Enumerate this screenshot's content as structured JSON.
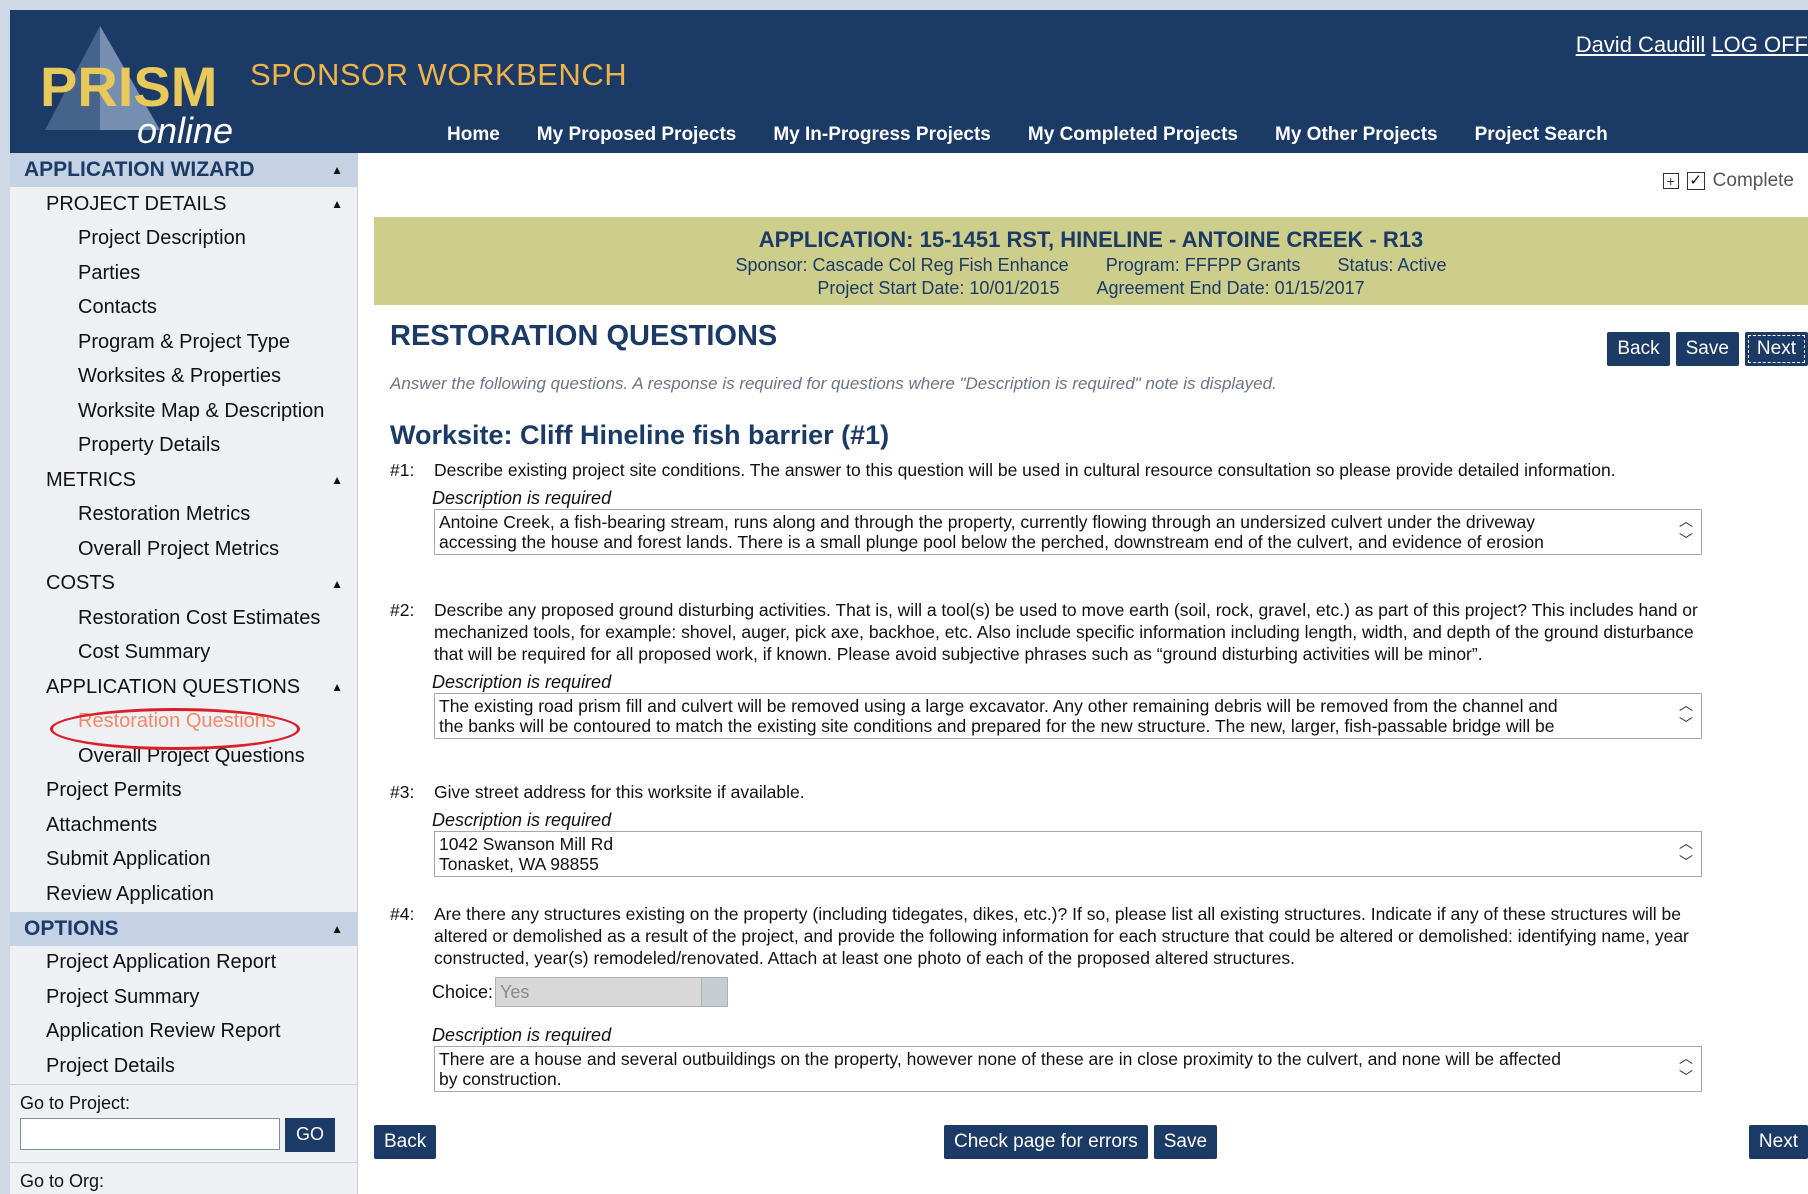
{
  "app": {
    "logo_text": "PRISM",
    "logo_sub": "online",
    "title": "SPONSOR WORKBENCH"
  },
  "user": {
    "name": "David Caudill",
    "logoff": "LOG OFF"
  },
  "nav": {
    "items": [
      "Home",
      "My Proposed Projects",
      "My In-Progress Projects",
      "My Completed Projects",
      "My Other Projects",
      "Project Search"
    ]
  },
  "sidebar": {
    "wizard_header": "APPLICATION WIZARD",
    "project_details": "PROJECT DETAILS",
    "project_details_items": [
      "Project Description",
      "Parties",
      "Contacts",
      "Program & Project Type",
      "Worksites & Properties",
      "Worksite Map & Description",
      "Property Details"
    ],
    "metrics": "METRICS",
    "metrics_items": [
      "Restoration Metrics",
      "Overall Project Metrics"
    ],
    "costs": "COSTS",
    "costs_items": [
      "Restoration Cost Estimates",
      "Cost Summary"
    ],
    "app_questions": "APPLICATION QUESTIONS",
    "app_questions_items": [
      "Restoration Questions",
      "Overall Project Questions"
    ],
    "other_items": [
      "Project Permits",
      "Attachments",
      "Submit Application",
      "Review Application"
    ],
    "options_header": "OPTIONS",
    "options_items": [
      "Project Application Report",
      "Project Summary",
      "Application Review Report",
      "Project Details"
    ],
    "go_project_label": "Go to Project:",
    "go_button": "GO",
    "go_org_label": "Go to Org:"
  },
  "status": {
    "complete_label": "Complete",
    "complete_checked": "✓"
  },
  "banner": {
    "title": "APPLICATION: 15-1451 RST, HINELINE - ANTOINE CREEK - R13",
    "sponsor": "Sponsor: Cascade Col Reg Fish Enhance",
    "program": "Program: FFFPP Grants",
    "status": "Status: Active",
    "start_date": "Project Start Date: 10/01/2015",
    "end_date": "Agreement End Date: 01/15/2017"
  },
  "page": {
    "title": "RESTORATION QUESTIONS",
    "instructions": "Answer the following questions. A response is required for questions where \"Description is required\" note is displayed.",
    "worksite": "Worksite: Cliff Hineline fish barrier (#1)"
  },
  "buttons": {
    "back": "Back",
    "save": "Save",
    "next": "Next",
    "check_errors": "Check page for errors"
  },
  "questions": [
    {
      "num": "#1:",
      "text": "Describe existing project site conditions. The answer to this question will be used in cultural resource consultation so please provide detailed information.",
      "req": "Description is required",
      "answer_line1": "Antoine Creek, a fish-bearing stream, runs along and through the property, currently flowing through an undersized culvert under the driveway",
      "answer_line2": "accessing the house and forest lands. There is a small plunge pool below the perched, downstream end of the culvert, and evidence of erosion"
    },
    {
      "num": "#2:",
      "text": "Describe any proposed ground disturbing activities. That is, will a tool(s) be used to move earth (soil, rock, gravel, etc.) as part of this project? This includes hand or mechanized tools, for example: shovel, auger, pick axe, backhoe, etc. Also include specific information including length, width, and depth of the ground disturbance that will be required for all proposed work, if known. Please avoid subjective phrases such as “ground disturbing activities will be minor”.",
      "req": "Description is required",
      "answer_line1": "The existing road prism fill and culvert will be removed using a large excavator. Any other remaining debris will be removed from the channel and",
      "answer_line2": "the banks will be contoured to match the existing site conditions and prepared for the new structure. The new, larger, fish-passable bridge will be"
    },
    {
      "num": "#3:",
      "text": "Give street address for this worksite if available.",
      "req": "Description is required",
      "answer_line1": "1042 Swanson Mill Rd",
      "answer_line2": "Tonasket, WA 98855"
    },
    {
      "num": "#4:",
      "text": "Are there any structures existing on the property (including tidegates, dikes, etc.)? If so, please list all existing structures. Indicate if any of these structures will be altered or demolished as a result of the project, and provide the following information for each structure that could be altered or demolished: identifying name, year constructed, year(s) remodeled/renovated. Attach at least one photo of each of the proposed altered structures.",
      "choice_label": "Choice:",
      "choice_value": "Yes",
      "req": "Description is required",
      "answer_line1": "There are a house and several outbuildings on the property, however none of these are in close proximity to the culvert, and none will be affected",
      "answer_line2": "by construction."
    }
  ],
  "colors": {
    "navy": "#1b3a66",
    "gold": "#e8c95a",
    "orange_title": "#f0b34a",
    "banner": "#cdcd8c",
    "highlight_oval": "#d8202a"
  }
}
